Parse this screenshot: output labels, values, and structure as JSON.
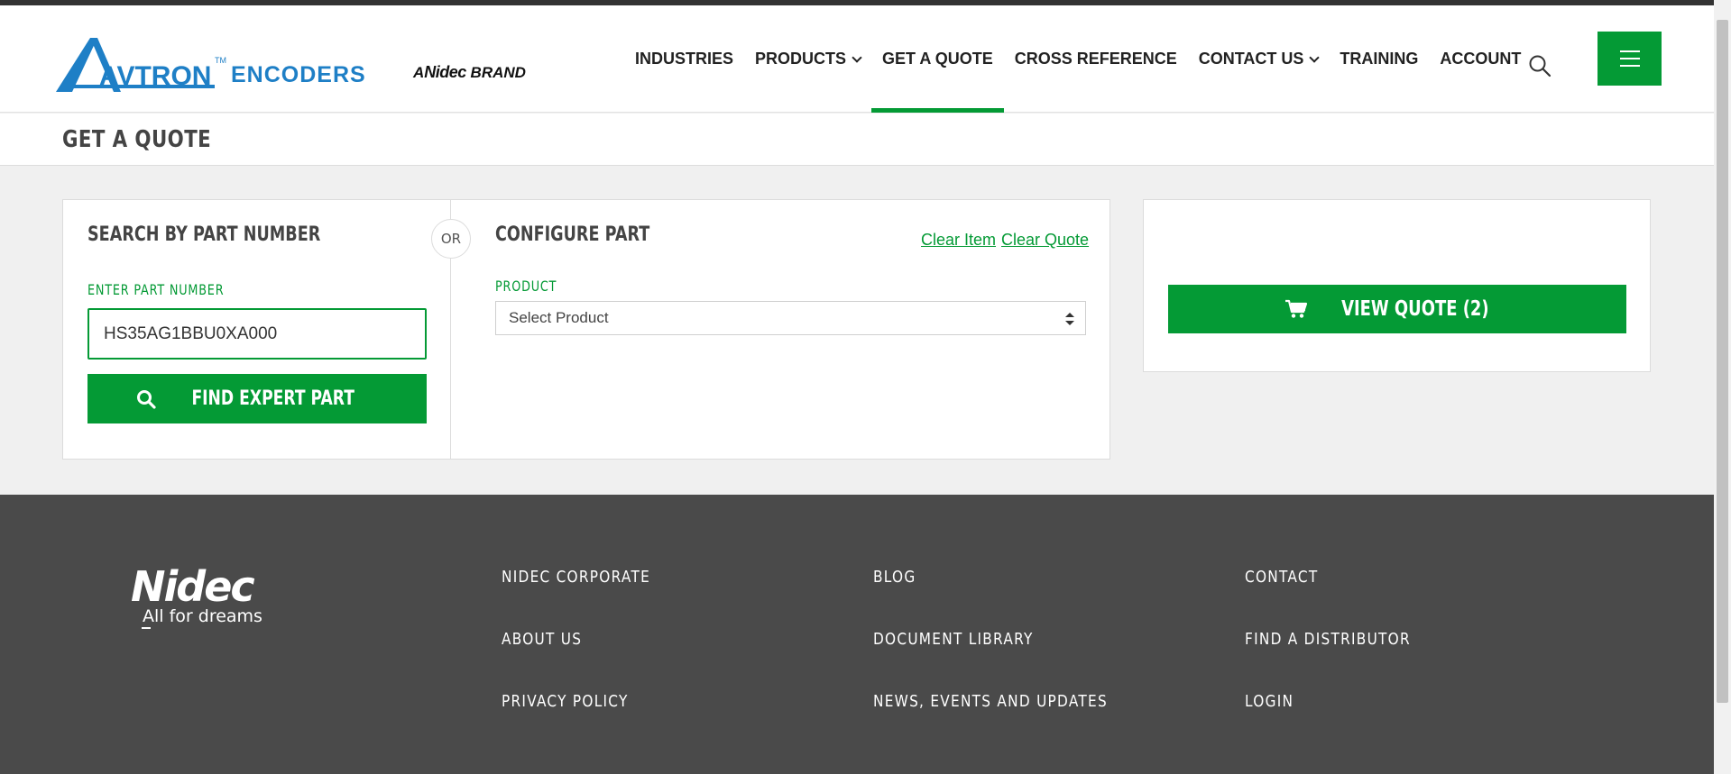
{
  "brand": {
    "logo_text_avtron": "AVTRON",
    "logo_tm": "TM",
    "logo_text_encoders": "ENCODERS",
    "tag_prefix": "A",
    "tag_nidec": "Nidec",
    "tag_suffix": " BRAND"
  },
  "nav": {
    "items": [
      {
        "label": "INDUSTRIES"
      },
      {
        "label": "PRODUCTS"
      },
      {
        "label": "GET A QUOTE"
      },
      {
        "label": "CROSS REFERENCE"
      },
      {
        "label": "CONTACT US"
      },
      {
        "label": "TRAINING"
      },
      {
        "label": "ACCOUNT"
      }
    ],
    "active": "GET A QUOTE"
  },
  "page": {
    "title": "GET A QUOTE"
  },
  "search_part": {
    "heading": "SEARCH BY PART NUMBER",
    "label": "ENTER PART NUMBER",
    "value": "HS35AG1BBU0XA000",
    "button": "FIND EXPERT PART",
    "or": "OR"
  },
  "configure": {
    "heading": "CONFIGURE PART",
    "clear_item": "Clear Item",
    "clear_quote": "Clear Quote",
    "product_label": "PRODUCT",
    "product_value": "Select Product"
  },
  "quote": {
    "button": "VIEW QUOTE (2)"
  },
  "footer": {
    "logo_text": "Nidec",
    "tagline": "All for dreams",
    "col1": [
      "NIDEC CORPORATE",
      "ABOUT US",
      "PRIVACY POLICY"
    ],
    "col2": [
      "BLOG",
      "DOCUMENT LIBRARY",
      "NEWS, EVENTS AND UPDATES"
    ],
    "col3": [
      "CONTACT",
      "FIND A DISTRIBUTOR",
      "LOGIN"
    ]
  },
  "colors": {
    "accent": "#049a35",
    "logo_blue": "#1e7fc6",
    "footer_bg": "#4a4a4a"
  }
}
